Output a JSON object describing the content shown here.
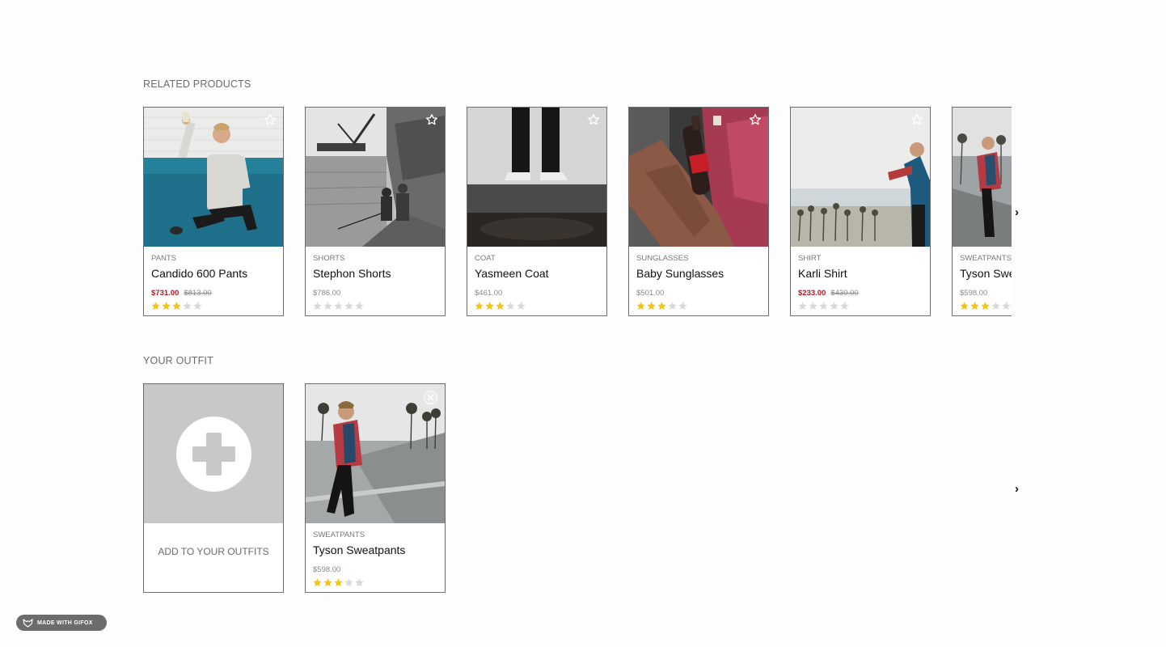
{
  "related": {
    "title": "RELATED PRODUCTS",
    "next_arrow": "›",
    "products": [
      {
        "category": "PANTS",
        "name": "Candido 600 Pants",
        "price": "$731.00",
        "original_price": "$813.00",
        "on_sale": true,
        "rating": 3,
        "image": "man-on-teal-sofa"
      },
      {
        "category": "SHORTS",
        "name": "Stephon Shorts",
        "price": "$786.00",
        "original_price": "",
        "on_sale": false,
        "rating": 0,
        "image": "harbor-fishermen"
      },
      {
        "category": "COAT",
        "name": "Yasmeen Coat",
        "price": "$461.00",
        "original_price": "",
        "on_sale": false,
        "rating": 3,
        "image": "legs-on-rocks"
      },
      {
        "category": "SUNGLASSES",
        "name": "Baby Sunglasses",
        "price": "$501.00",
        "original_price": "",
        "on_sale": false,
        "rating": 3,
        "image": "cola-bottle-pocket"
      },
      {
        "category": "SHIRT",
        "name": "Karli Shirt",
        "price": "$233.00",
        "original_price": "$430.00",
        "on_sale": true,
        "rating": 0,
        "image": "man-at-beach-palms"
      },
      {
        "category": "SWEATPANTS",
        "name": "Tyson Sweatpants",
        "price": "$598.00",
        "original_price": "",
        "on_sale": false,
        "rating": 3,
        "image": "man-on-railing"
      }
    ]
  },
  "outfit": {
    "title": "YOUR OUTFIT",
    "add_label": "ADD TO YOUR OUTFITS",
    "next_arrow": "›",
    "products": [
      {
        "category": "SWEATPANTS",
        "name": "Tyson Sweatpants",
        "price": "$598.00",
        "rating": 3,
        "image": "man-on-railing"
      }
    ]
  },
  "badge": {
    "text": "MADE WITH GIFOX"
  },
  "colors": {
    "star_filled": "#f6c512",
    "star_empty": "#dadada",
    "sale": "#c0141c",
    "add_bg": "#c7c8c7"
  }
}
